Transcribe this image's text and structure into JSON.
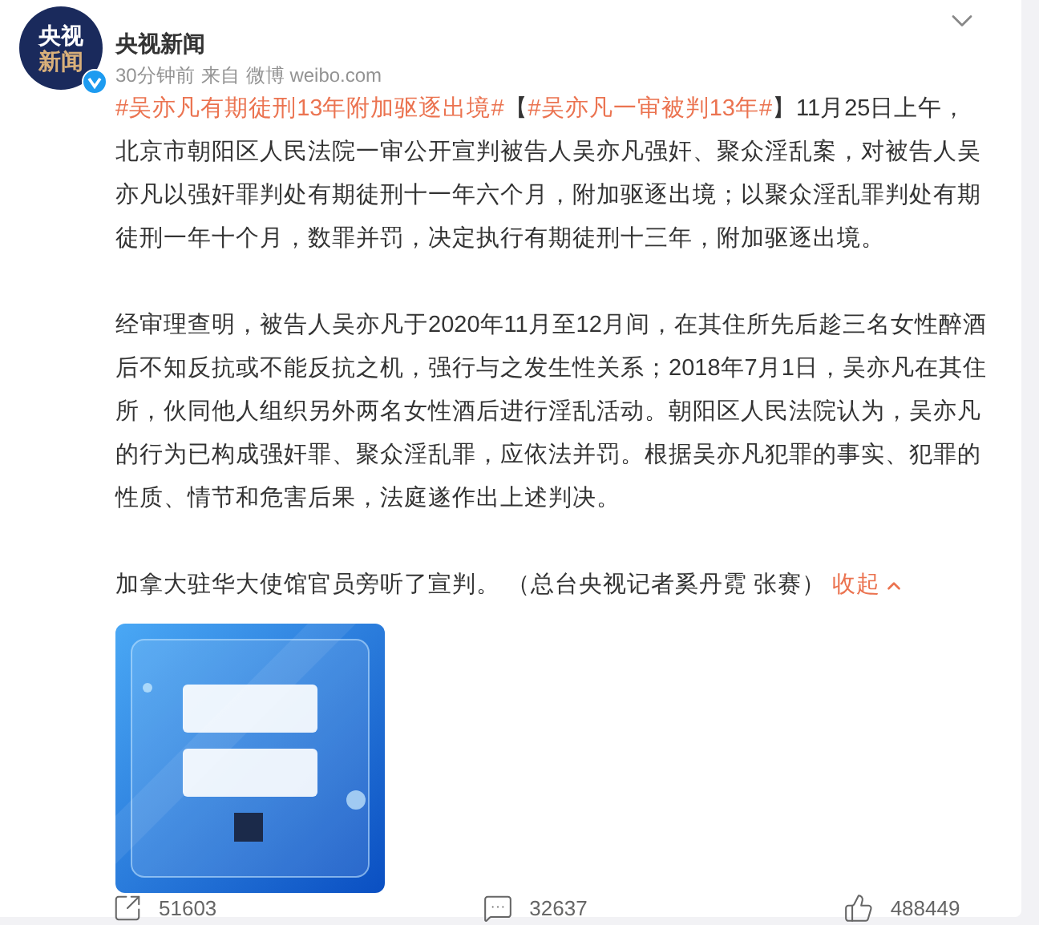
{
  "post": {
    "author": "央视新闻",
    "avatar_text": [
      "央视",
      "新闻"
    ],
    "verified": true,
    "time": "30分钟前",
    "source_prefix": "来自",
    "source": "微博 weibo.com",
    "paragraphs": [
      [
        {
          "kind": "topic",
          "text": "#吴亦凡有期徒刑13年附加驱逐出境#"
        },
        {
          "kind": "text",
          "text": "【"
        },
        {
          "kind": "topic",
          "text": "#吴亦凡一审被判13年#"
        },
        {
          "kind": "text",
          "text": "】11月25日上午，北京市朝阳区人民法院一审公开宣判被告人吴亦凡强奸、聚众淫乱案，对被告人吴亦凡以强奸罪判处有期徒刑十一年六个月，附加驱逐出境；以聚众淫乱罪判处有期徒刑一年十个月，数罪并罚，决定执行有期徒刑十三年，附加驱逐出境。"
        }
      ],
      [
        {
          "kind": "text",
          "text": "经审理查明，被告人吴亦凡于2020年11月至12月间，在其住所先后趁三名女性醉酒后不知反抗或不能反抗之机，强行与之发生性关系；2018年7月1日，吴亦凡在其住所，伙同他人组织另外两名女性酒后进行淫乱活动。朝阳区人民法院认为，吴亦凡的行为已构成强奸罪、聚众淫乱罪，应依法并罚。根据吴亦凡犯罪的事实、犯罪的性质、情节和危害后果，法庭遂作出上述判决。"
        }
      ],
      [
        {
          "kind": "text",
          "text": "加拿大驻华大使馆官员旁听了宣判。 （总台央视记者奚丹霓 张赛）"
        },
        {
          "kind": "collapse",
          "text": "收起"
        }
      ]
    ],
    "image": {
      "kind": "picture"
    }
  },
  "actions": [
    {
      "kind": "repost",
      "count": "51603"
    },
    {
      "kind": "comment",
      "count": "32637"
    },
    {
      "kind": "like",
      "count": "488449"
    }
  ]
}
